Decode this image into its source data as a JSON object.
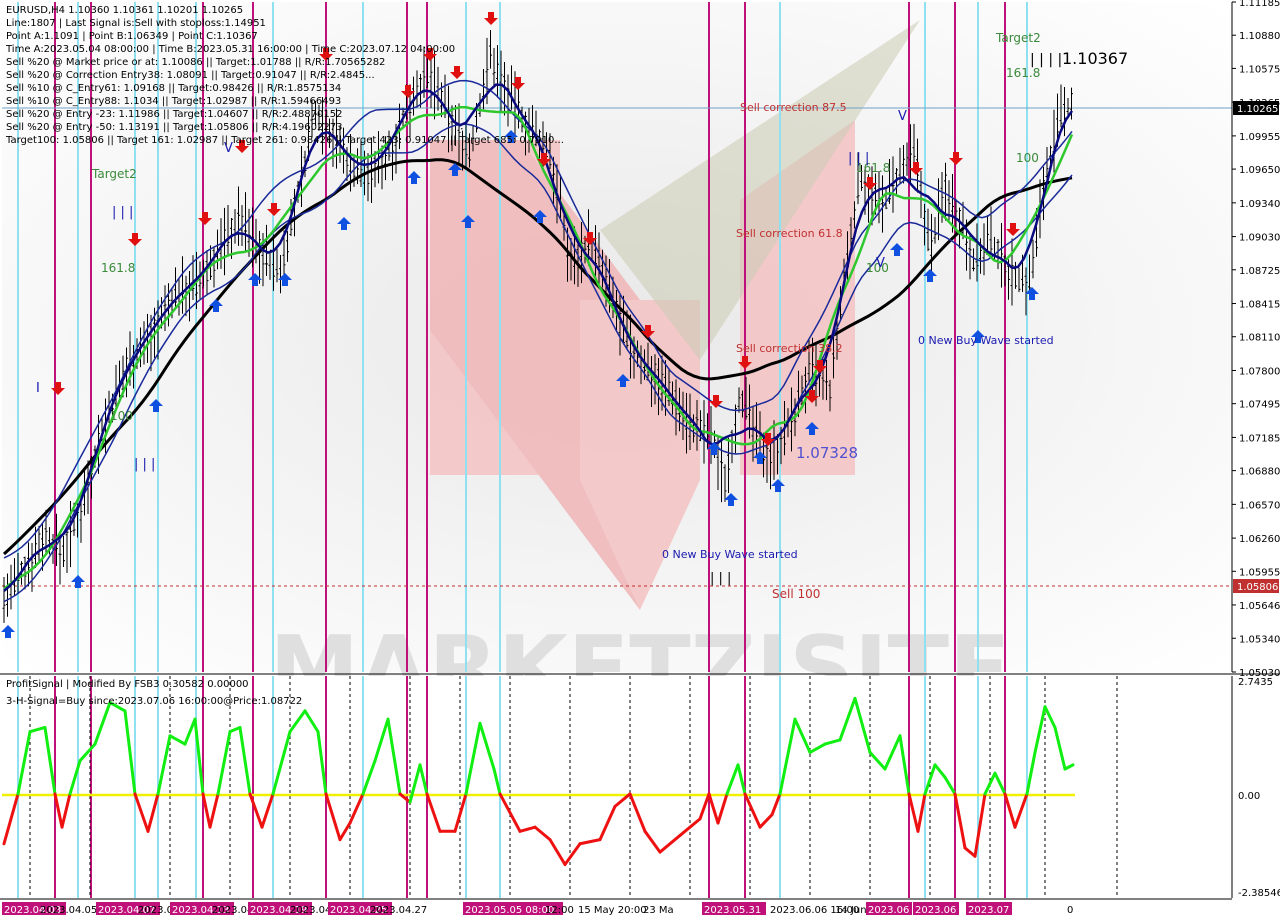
{
  "chart_data": [
    {
      "type": "candlestick",
      "symbol_label": "EURUSD,H4  1.10360 1.10361 1.10201 1.10265",
      "info_lines": [
        "Line:1807 | Last Signal is:Sell with stoploss:1.14951",
        "Point A:1.1091 | Point B:1.06349 | Point C:1.10367",
        "Time A:2023.05.04 08:00:00 | Time B:2023.05.31 16:00:00 | Time C:2023.07.12 04:00:00",
        "Sell %20 @ Market price or at: 1.10086 || Target:1.01788 || R/R:1.70565282",
        "Sell %20 @ Correction Entry38: 1.08091 || Target:0.91047 || R/R:2.4845...",
        "Sell %10 @ C_Entry61: 1.09168 || Target:0.98426 || R/R:1.8575134",
        "Sell %10 @ C_Entry88: 1.1034 || Target:1.02987 || R/R:1.59466493",
        "Sell %20 @ Entry -23: 1.11986 || Target:1.04607 || R/R:2.48870152",
        "Sell %20 @ Entry -50: 1.13191 || Target:1.05806 || R/R:4.19602273",
        "Target100: 1.05806 || Target 161: 1.02987 || Target 261: 0.98426 || Target 423: 0.91047 || Target 685: 0.7910..."
      ],
      "price_axis": {
        "ticks": [
          "1.11185",
          "1.10880",
          "1.10575",
          "1.10265",
          "1.09955",
          "1.09650",
          "1.09340",
          "1.09030",
          "1.08725",
          "1.08415",
          "1.08110",
          "1.07800",
          "1.07495",
          "1.07185",
          "1.06880",
          "1.06570",
          "1.06260",
          "1.05955",
          "1.05646",
          "1.05340",
          "1.05030"
        ],
        "ylim": [
          1.0503,
          1.11185
        ],
        "current_price_label": "1.10265",
        "current_price_color": "#ffffff",
        "target_price_label": "1.05806",
        "target_price_color": "#c03030"
      },
      "annotations": {
        "target2_left": "Target2",
        "target2_right": "Target2",
        "fib_1618_left": "161.8",
        "fib_1618_mid": "161.8",
        "fib_1618_right": "161.8",
        "fib_100_left": "100",
        "fib_100_mid": "100",
        "fib_100_right": "100",
        "sell_corr_875": "Sell correction 87.5",
        "sell_corr_618": "Sell correction 61.8",
        "sell_corr_382": "Sell correction 38.2",
        "sell_100": "Sell 100",
        "buy_wave_1": "0 New Buy Wave started",
        "buy_wave_2": "0 New Buy Wave started",
        "price_label_c": "1.10367",
        "price_label_b": "1.07328",
        "wave_mark_a": "| | |",
        "wave_mark_b": "| | |",
        "wave_mark_c": "| | | |",
        "wave_mark_d": "| | |",
        "wave_mark_e": "| | |",
        "wave_mark_i": "I",
        "wave_mark_v1": "V",
        "wave_mark_v2": "V",
        "wave_mark_v3": "V",
        "watermark": "MARKETZISITE"
      },
      "colors": {
        "ma_slow": "#000000",
        "ma_green": "#2ec82e",
        "ma_navy": "#0a0a80",
        "envelope": "#1a2a9a",
        "sell_arrow": "#e01010",
        "buy_arrow": "#1050e0",
        "signal_vline": "#c0107a",
        "cyan_vline": "#8fe0f0",
        "sell_zone": "#f0b0b0",
        "candles": "#000000"
      }
    },
    {
      "type": "line",
      "title": "ProfitSignal | Modified By FSB3 0.30582 0.00000",
      "subtitle": "3-H-Signal=Buy since:2023.07.06 16:00:00@Price:1.08722",
      "yticks": [
        "2.7435",
        "0.00",
        "-2.38546"
      ],
      "ylim": [
        -2.38546,
        2.7435
      ],
      "colors": {
        "positive": "#11ee11",
        "negative": "#ee1111",
        "zero_line": "#f0f000"
      }
    }
  ],
  "time_axis": {
    "labels": [
      {
        "text": "2023.04.03",
        "highlight": true
      },
      {
        "text": "2023.04.05",
        "highlight": false
      },
      {
        "text": "2023.04.07",
        "highlight": true
      },
      {
        "text": "2023.04.11",
        "highlight": false
      },
      {
        "text": "2023.04.13",
        "highlight": true
      },
      {
        "text": "2023.04.17",
        "highlight": false
      },
      {
        "text": "2023.04.19",
        "highlight": true
      },
      {
        "text": "2023.04.21",
        "highlight": false
      },
      {
        "text": "2023.04.25",
        "highlight": true
      },
      {
        "text": "2023.04.27",
        "highlight": false
      },
      {
        "text": "2023.05.05 08:00",
        "highlight": true
      },
      {
        "text": "12:00",
        "highlight": false
      },
      {
        "text": "15 May 20:00",
        "highlight": false
      },
      {
        "text": "23 Ma",
        "highlight": false
      },
      {
        "text": "2023.05.31",
        "highlight": true
      },
      {
        "text": "2023.06.06 16:00",
        "highlight": false
      },
      {
        "text": "14 Jun 1",
        "highlight": false
      },
      {
        "text": "2023.06",
        "highlight": true
      },
      {
        "text": "2023.06",
        "highlight": true
      },
      {
        "text": "2023.07",
        "highlight": true
      },
      {
        "text": "0",
        "highlight": false
      }
    ]
  }
}
